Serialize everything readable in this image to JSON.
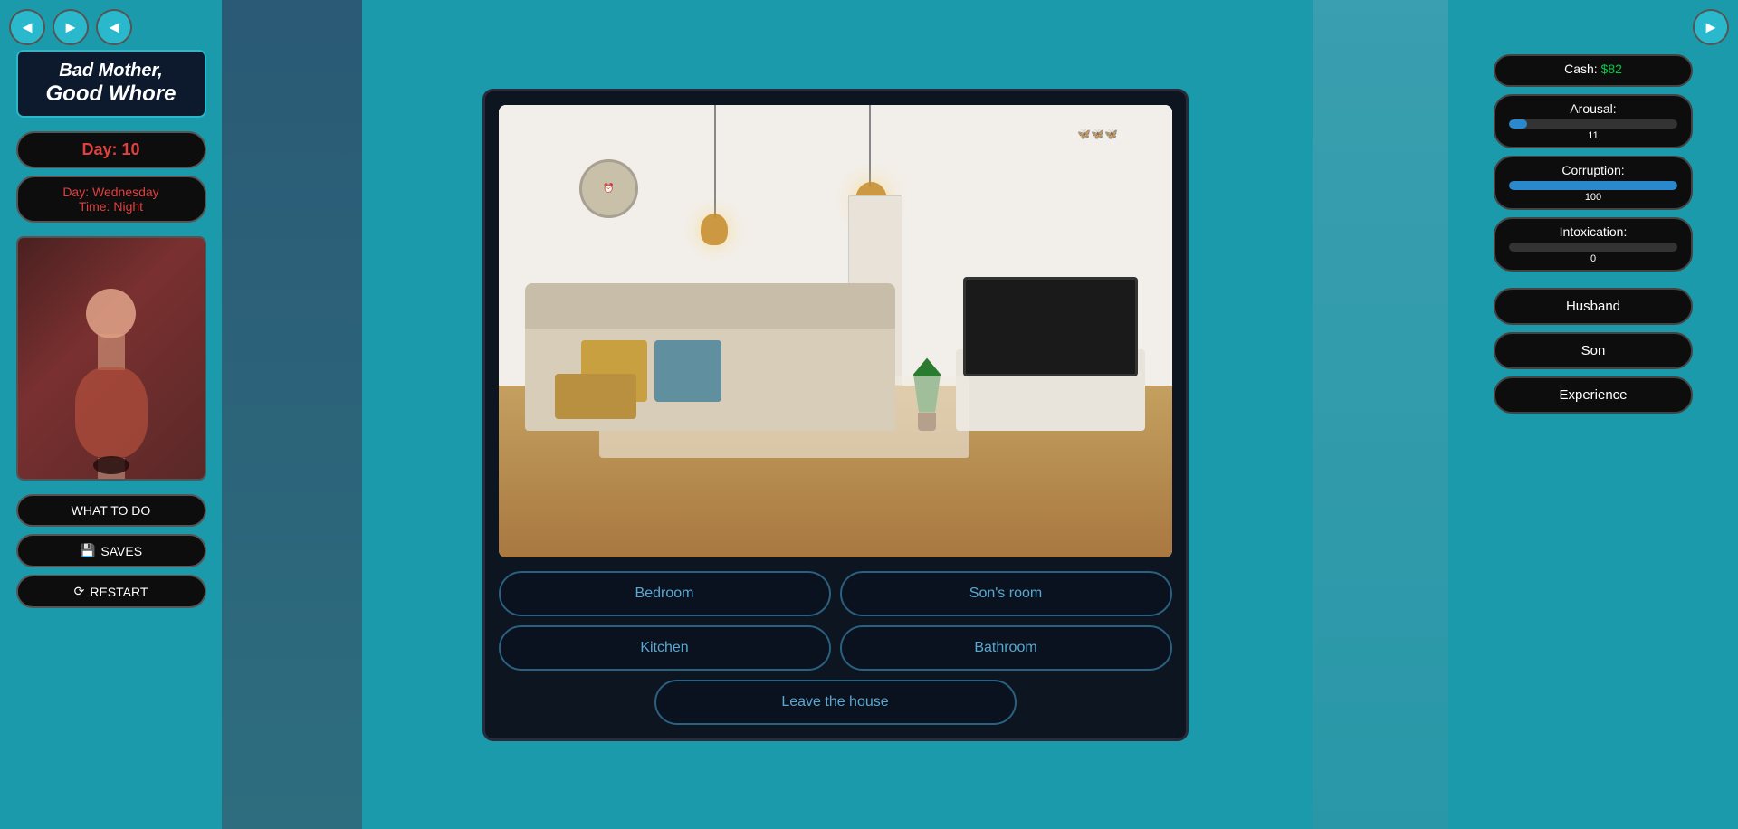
{
  "game": {
    "title_line1": "Bad Mother,",
    "title_line2": "Good Whore"
  },
  "status": {
    "day_label": "Day:",
    "day_value": "10",
    "day_name_label": "Day:",
    "day_name_value": "Wednesday",
    "time_label": "Time:",
    "time_value": "Night"
  },
  "stats": {
    "cash_label": "Cash:",
    "cash_value": "$82",
    "arousal_label": "Arousal:",
    "arousal_value": "11",
    "arousal_percent": 11,
    "corruption_label": "Corruption:",
    "corruption_value": "100",
    "corruption_percent": 100,
    "intoxication_label": "Intoxication:",
    "intoxication_value": "0",
    "intoxication_percent": 0
  },
  "relations": {
    "husband_label": "Husband",
    "son_label": "Son",
    "experience_label": "Experience"
  },
  "nav": {
    "back_arrow": "◄",
    "forward_arrow": "►",
    "left_arrow": "◄"
  },
  "sidebar": {
    "what_to_do_label": "WHAT TO DO",
    "saves_label": "SAVES",
    "saves_icon": "💾",
    "restart_label": "RESTART",
    "restart_icon": "⟳"
  },
  "actions": {
    "bedroom_label": "Bedroom",
    "sons_room_label": "Son's room",
    "kitchen_label": "Kitchen",
    "bathroom_label": "Bathroom",
    "leave_house_label": "Leave the house"
  }
}
